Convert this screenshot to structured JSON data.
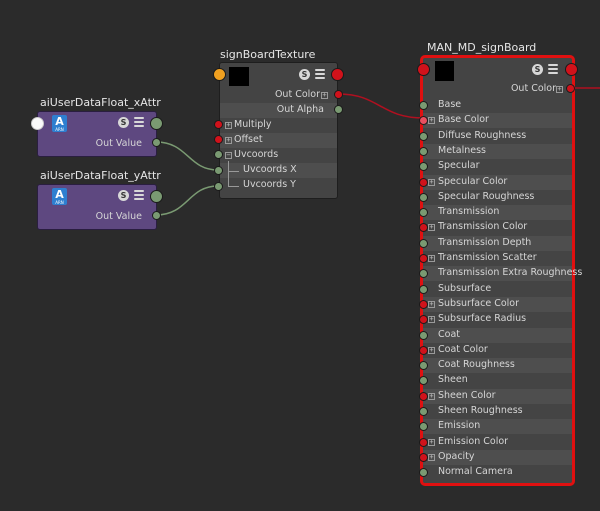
{
  "nodes": {
    "xattr": {
      "title": "aiUserDataFloat_xAttr",
      "out_label": "Out Value",
      "logo": "A",
      "logo_sub": "ARN"
    },
    "yattr": {
      "title": "aiUserDataFloat_yAttr",
      "out_label": "Out Value",
      "logo": "A",
      "logo_sub": "ARN"
    },
    "texture": {
      "title": "signBoardTexture",
      "rows": [
        "Out Color",
        "Out Alpha",
        "Multiply",
        "Offset",
        "Uvcoords",
        "Uvcoords X",
        "Uvcoords Y"
      ]
    },
    "material": {
      "title": "MAN_MD_signBoard",
      "out_label": "Out Color",
      "rows": [
        "Base",
        "Base Color",
        "Diffuse Roughness",
        "Metalness",
        "Specular",
        "Specular Color",
        "Specular Roughness",
        "Transmission",
        "Transmission Color",
        "Transmission Depth",
        "Transmission Scatter",
        "Transmission Extra Roughness",
        "Subsurface",
        "Subsurface Color",
        "Subsurface Radius",
        "Coat",
        "Coat Color",
        "Coat Roughness",
        "Sheen",
        "Sheen Color",
        "Sheen Roughness",
        "Emission",
        "Emission Color",
        "Opacity",
        "Normal Camera"
      ]
    }
  },
  "icons": {
    "swatch": "swatch-icon",
    "s": "S",
    "menu": "list-icon"
  },
  "colors": {
    "background": "#2b2b2b",
    "node_body": "#444444",
    "utility_node": "#5e4880",
    "selected_border": "#e01010",
    "port_green": "#7a9a72",
    "port_red": "#d0121b",
    "wire_red": "#b01020",
    "wire_green": "#7a9a72"
  }
}
